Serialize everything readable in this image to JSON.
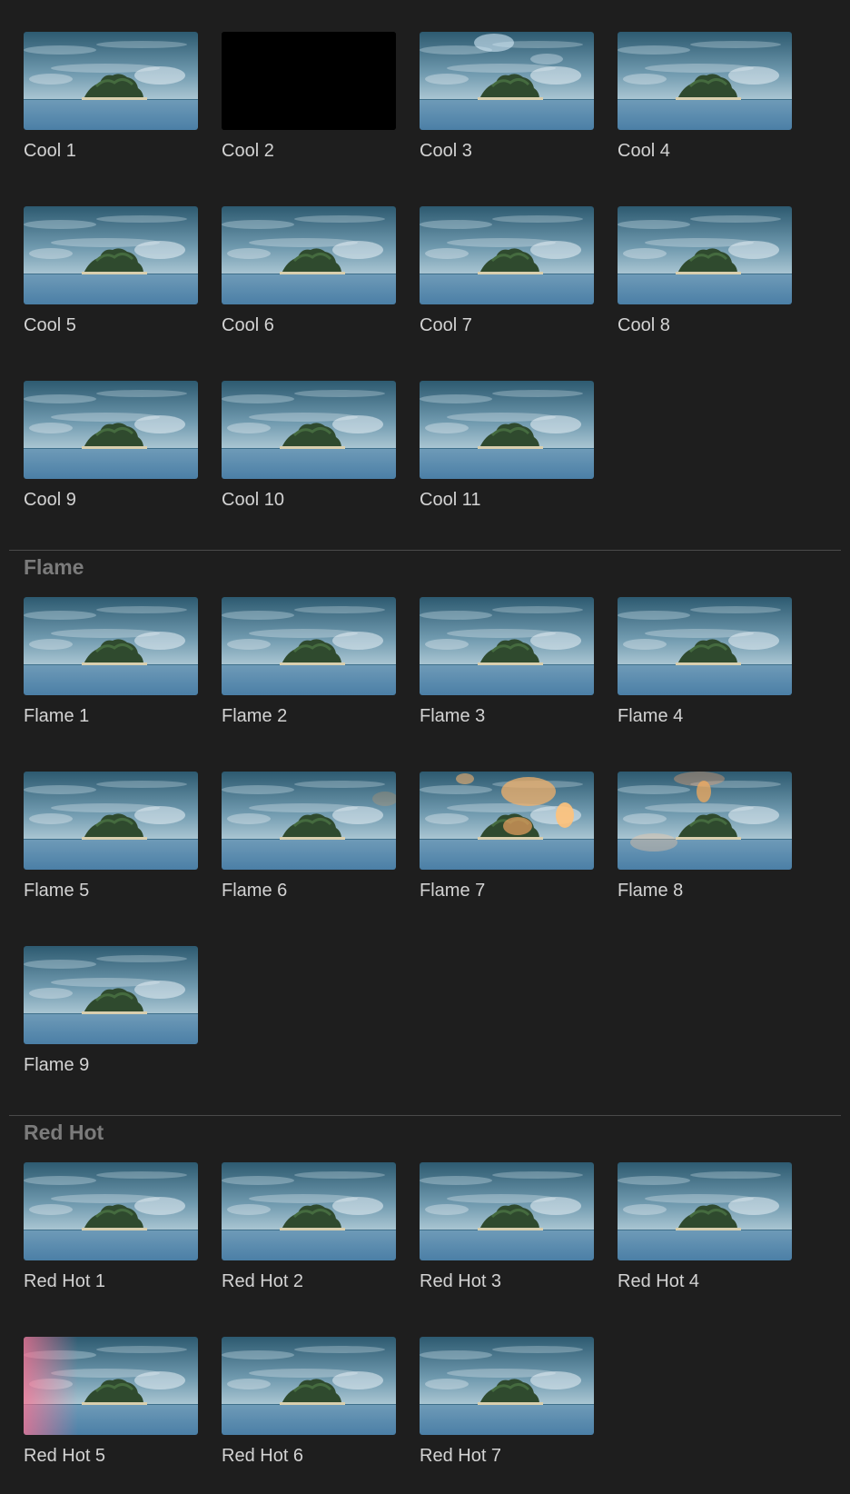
{
  "sections": [
    {
      "id": "cool",
      "title": "",
      "items": [
        {
          "label": "Cool 1",
          "effect": "none"
        },
        {
          "label": "Cool 2",
          "effect": "black"
        },
        {
          "label": "Cool 3",
          "effect": "cool-glow"
        },
        {
          "label": "Cool 4",
          "effect": "none"
        },
        {
          "label": "Cool 5",
          "effect": "none"
        },
        {
          "label": "Cool 6",
          "effect": "none"
        },
        {
          "label": "Cool 7",
          "effect": "none"
        },
        {
          "label": "Cool 8",
          "effect": "none"
        },
        {
          "label": "Cool 9",
          "effect": "none"
        },
        {
          "label": "Cool 10",
          "effect": "none"
        },
        {
          "label": "Cool 11",
          "effect": "none"
        }
      ]
    },
    {
      "id": "flame",
      "title": "Flame",
      "items": [
        {
          "label": "Flame 1",
          "effect": "none"
        },
        {
          "label": "Flame 2",
          "effect": "none"
        },
        {
          "label": "Flame 3",
          "effect": "none"
        },
        {
          "label": "Flame 4",
          "effect": "none"
        },
        {
          "label": "Flame 5",
          "effect": "none"
        },
        {
          "label": "Flame 6",
          "effect": "faint-warm"
        },
        {
          "label": "Flame 7",
          "effect": "flame-strong"
        },
        {
          "label": "Flame 8",
          "effect": "flame-soft"
        },
        {
          "label": "Flame 9",
          "effect": "none"
        }
      ]
    },
    {
      "id": "red-hot",
      "title": "Red Hot",
      "items": [
        {
          "label": "Red Hot 1",
          "effect": "none"
        },
        {
          "label": "Red Hot 2",
          "effect": "none"
        },
        {
          "label": "Red Hot 3",
          "effect": "none"
        },
        {
          "label": "Red Hot 4",
          "effect": "none"
        },
        {
          "label": "Red Hot 5",
          "effect": "red-leak"
        },
        {
          "label": "Red Hot 6",
          "effect": "none"
        },
        {
          "label": "Red Hot 7",
          "effect": "none"
        }
      ]
    }
  ],
  "colors": {
    "background": "#1e1e1e",
    "label": "#d3d3d3",
    "section_title": "#7b7b7b",
    "divider": "#4a4a4a"
  }
}
